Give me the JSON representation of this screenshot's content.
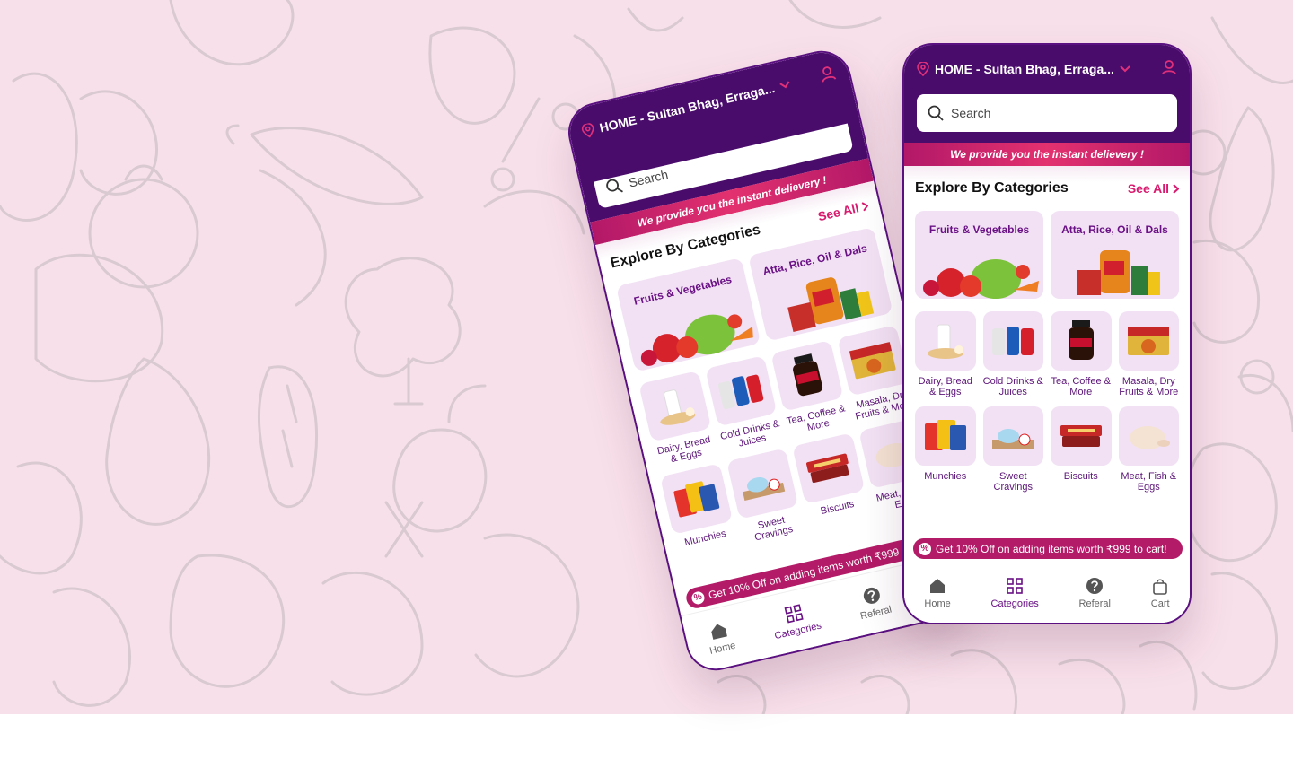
{
  "app": {
    "location": "HOME - Sultan Bhag, Erraga...",
    "search_placeholder": "Search",
    "banner": "We provide you the instant delievery !",
    "section_title": "Explore By Categories",
    "see_all": "See All",
    "promo": "Get 10% Off on adding items worth ₹999 to cart!",
    "promo_badge": "%",
    "big_categories": [
      {
        "label": "Fruits & Vegetables",
        "icon": "vegetables-image"
      },
      {
        "label": "Atta, Rice, Oil & Dals",
        "icon": "grocery-staples-image"
      }
    ],
    "categories": [
      {
        "label": "Dairy, Bread & Eggs",
        "icon": "dairy-image"
      },
      {
        "label": "Cold Drinks & Juices",
        "icon": "cold-drinks-image"
      },
      {
        "label": "Tea, Coffee & More",
        "icon": "coffee-jar-image"
      },
      {
        "label": "Masala, Dry Fruits & More",
        "icon": "masala-box-image"
      },
      {
        "label": "Munchies",
        "icon": "chips-image"
      },
      {
        "label": "Sweet Cravings",
        "icon": "ice-cream-image"
      },
      {
        "label": "Biscuits",
        "icon": "biscuits-image"
      },
      {
        "label": "Meat, Fish & Eggs",
        "icon": "chicken-image"
      }
    ],
    "nav": [
      {
        "label": "Home",
        "icon": "home-icon"
      },
      {
        "label": "Categories",
        "icon": "grid-icon",
        "active": true
      },
      {
        "label": "Referal",
        "icon": "question-icon"
      },
      {
        "label": "Cart",
        "icon": "bag-icon"
      }
    ]
  },
  "colors": {
    "background": "#f8e0ea",
    "header": "#4a0c6b",
    "accent": "#d81b6f",
    "card": "#f2e1f4",
    "promo": "#b31a67"
  }
}
